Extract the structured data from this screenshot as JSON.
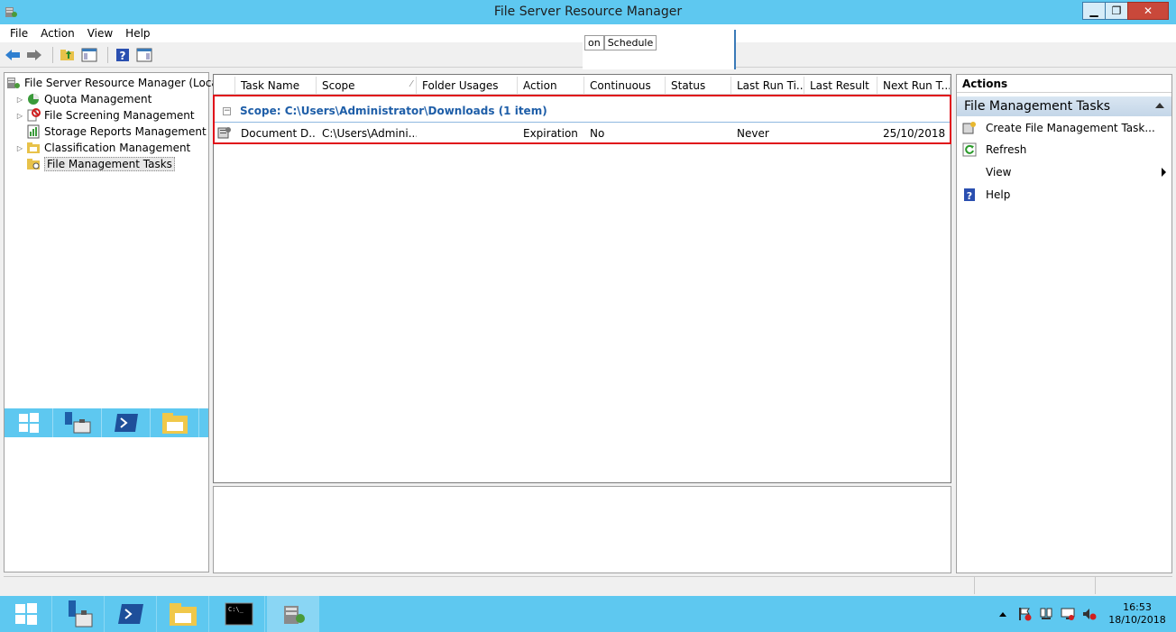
{
  "window": {
    "title": "File Server Resource Manager",
    "minimize": "▁",
    "restore": "❐",
    "close": "✕"
  },
  "menu": [
    "File",
    "Action",
    "View",
    "Help"
  ],
  "ghost_window": {
    "tabs": [
      "on",
      "Schedule"
    ]
  },
  "tree": {
    "root": "File Server Resource Manager (Local)",
    "items": [
      {
        "label": "Quota Management",
        "expandable": true
      },
      {
        "label": "File Screening Management",
        "expandable": true
      },
      {
        "label": "Storage Reports Management",
        "expandable": false
      },
      {
        "label": "Classification Management",
        "expandable": true
      },
      {
        "label": "File Management Tasks",
        "expandable": false,
        "selected": true
      }
    ]
  },
  "list": {
    "columns": [
      "Task Name",
      "Scope",
      "Folder Usages",
      "Action",
      "Continuous",
      "Status",
      "Last Run Ti...",
      "Last Result",
      "Next Run T..."
    ],
    "group_header": "Scope: C:\\Users\\Administrator\\Downloads (1 item)",
    "collapse_symbol": "−",
    "rows": [
      {
        "task_name": "Document D...",
        "scope": "C:\\Users\\Admini...",
        "folder_usages": "",
        "action": "Expiration",
        "continuous": "No",
        "status": "",
        "last_run": "Never",
        "last_result": "",
        "next_run": "25/10/2018 ..."
      }
    ]
  },
  "actions": {
    "header": "Actions",
    "section": "File Management Tasks",
    "items": [
      {
        "label": "Create File Management Task...",
        "icon": "create-task-icon"
      },
      {
        "label": "Refresh",
        "icon": "refresh-icon"
      },
      {
        "label": "View",
        "icon": "",
        "submenu": true
      },
      {
        "label": "Help",
        "icon": "help-icon"
      }
    ]
  },
  "clock": {
    "time": "16:53",
    "date": "18/10/2018"
  },
  "colors": {
    "titlebar": "#5ec8f0",
    "taskbar": "#5ec8f0",
    "group_header_text": "#1e5ea8",
    "highlight_box": "#e0101a"
  }
}
